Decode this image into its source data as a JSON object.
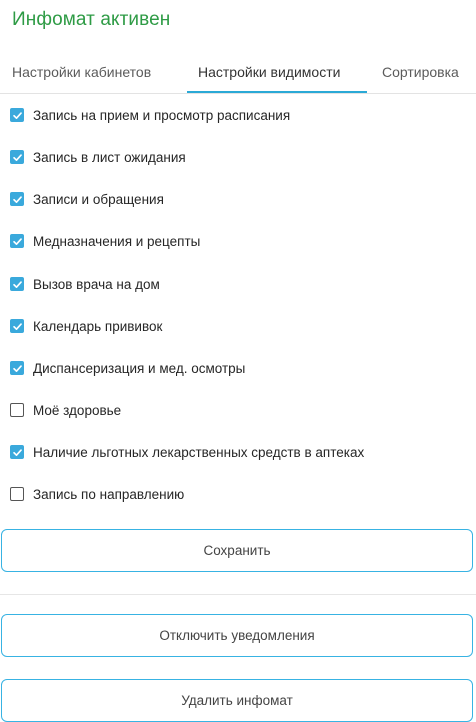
{
  "header": {
    "title": "Инфомат активен"
  },
  "tabs": [
    {
      "label": "Настройки кабинетов"
    },
    {
      "label": "Настройки видимости"
    },
    {
      "label": "Сортировка"
    }
  ],
  "active_tab": "Настройки видимости",
  "checkboxes": [
    {
      "label": "Запись на прием и просмотр расписания",
      "checked": true
    },
    {
      "label": "Запись в лист ожидания",
      "checked": true
    },
    {
      "label": "Записи и обращения",
      "checked": true
    },
    {
      "label": "Медназначения и рецепты",
      "checked": true
    },
    {
      "label": "Вызов врача на дом",
      "checked": true
    },
    {
      "label": "Календарь прививок",
      "checked": true
    },
    {
      "label": "Диспансеризация и мед. осмотры",
      "checked": true
    },
    {
      "label": "Моё здоровье",
      "checked": false
    },
    {
      "label": "Наличие льготных лекарственных средств в аптеках",
      "checked": true
    },
    {
      "label": "Запись по направлению",
      "checked": false
    }
  ],
  "buttons": {
    "save": "Сохранить",
    "disable_notifications": "Отключить уведомления",
    "delete_infomat": "Удалить инфомат"
  },
  "colors": {
    "title": "#2e9b45",
    "accent": "#3aa9dc",
    "button_border": "#38b3e3"
  }
}
